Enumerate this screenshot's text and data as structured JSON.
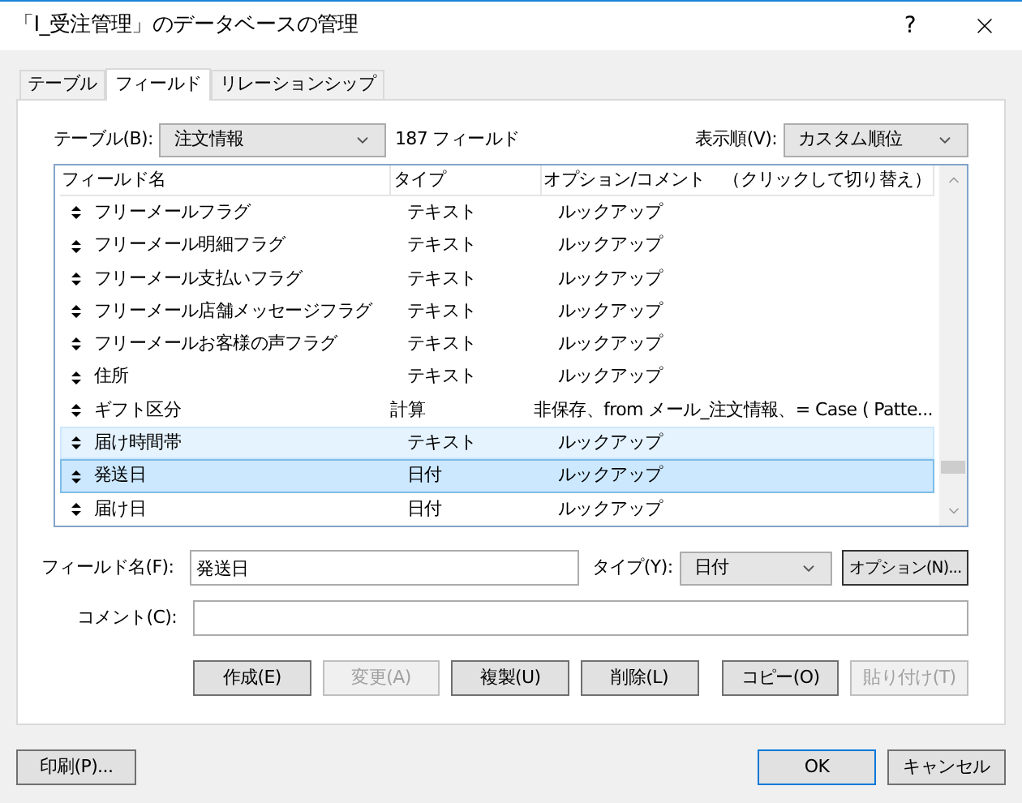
{
  "window": {
    "title": "「I_受注管理」のデータベースの管理",
    "help": "?"
  },
  "tabs": [
    {
      "label": "テーブル",
      "selected": false
    },
    {
      "label": "フィールド",
      "selected": true
    },
    {
      "label": "リレーションシップ",
      "selected": false
    }
  ],
  "table_select": {
    "label": "テーブル(B):",
    "value": "注文情報",
    "count": "187 フィールド"
  },
  "sort_select": {
    "label": "表示順(V):",
    "value": "カスタム順位"
  },
  "table": {
    "columns": [
      "フィールド名",
      "タイプ",
      "オプション/コメント　（クリックして切り替え）"
    ],
    "rows": [
      {
        "name": "フリーメールフラグ",
        "type": "テキスト",
        "options": "ルックアップ",
        "selected": false,
        "hovered": false
      },
      {
        "name": "フリーメール明細フラグ",
        "type": "テキスト",
        "options": "ルックアップ",
        "selected": false,
        "hovered": false
      },
      {
        "name": "フリーメール支払いフラグ",
        "type": "テキスト",
        "options": "ルックアップ",
        "selected": false,
        "hovered": false
      },
      {
        "name": "フリーメール店舗メッセージフラグ",
        "type": "テキスト",
        "options": "ルックアップ",
        "selected": false,
        "hovered": false
      },
      {
        "name": "フリーメールお客様の声フラグ",
        "type": "テキスト",
        "options": "ルックアップ",
        "selected": false,
        "hovered": false
      },
      {
        "name": "住所",
        "type": "テキスト",
        "options": "ルックアップ",
        "selected": false,
        "hovered": false
      },
      {
        "name": "ギフト区分",
        "type": "計算",
        "options": "非保存、from メール_注文情報、= Case (  Patte...",
        "selected": false,
        "hovered": false
      },
      {
        "name": "届け時間帯",
        "type": "テキスト",
        "options": "ルックアップ",
        "selected": false,
        "hovered": true
      },
      {
        "name": "発送日",
        "type": "日付",
        "options": "ルックアップ",
        "selected": true,
        "hovered": false
      },
      {
        "name": "届け日",
        "type": "日付",
        "options": "ルックアップ",
        "selected": false,
        "hovered": false
      }
    ]
  },
  "field_name": {
    "label": "フィールド名(F):",
    "value": "発送日"
  },
  "type_select": {
    "label": "タイプ(Y):",
    "value": "日付"
  },
  "options_button": "オプション(N)...",
  "comment": {
    "label": "コメント(C):"
  },
  "action_buttons": [
    {
      "label": "作成(E)",
      "disabled": false
    },
    {
      "label": "変更(A)",
      "disabled": true
    },
    {
      "label": "複製(U)",
      "disabled": false
    },
    {
      "label": "削除(L)",
      "disabled": false
    },
    {
      "label": "コピー(O)",
      "disabled": false
    },
    {
      "label": "貼り付け(T)",
      "disabled": true
    }
  ],
  "print_button": "印刷(P)...",
  "ok_button": "OK",
  "cancel_button": "キャンセル"
}
